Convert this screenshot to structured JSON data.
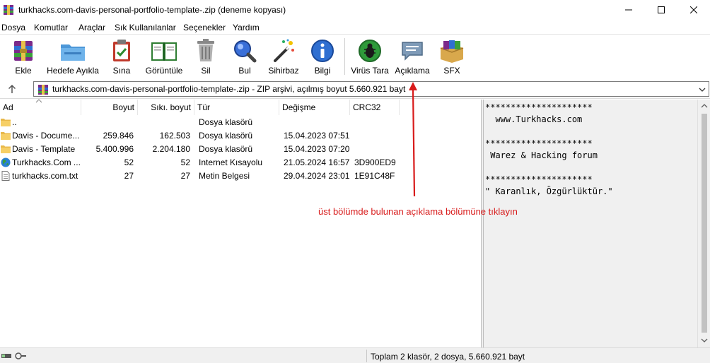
{
  "window": {
    "title": "turkhacks.com-davis-personal-portfolio-template-.zip (deneme kopyası)"
  },
  "menu": [
    "Dosya",
    "Komutlar",
    "Araçlar",
    "Sık Kullanılanlar",
    "Seçenekler",
    "Yardım"
  ],
  "toolbar": {
    "add": "Ekle",
    "extract_to": "Hedefe Ayıkla",
    "test": "Sına",
    "view": "Görüntüle",
    "delete": "Sil",
    "find": "Bul",
    "wizard": "Sihirbaz",
    "info": "Bilgi",
    "virus_scan": "Virüs Tara",
    "comment": "Açıklama",
    "sfx": "SFX"
  },
  "address": {
    "text": "turkhacks.com-davis-personal-portfolio-template-.zip - ZIP arşivi, açılmış boyut 5.660.921 bayt"
  },
  "columns": {
    "name": "Ad",
    "size": "Boyut",
    "packed": "Sıkı. boyut",
    "type": "Tür",
    "modified": "Değişme",
    "crc": "CRC32"
  },
  "files": [
    {
      "name": "..",
      "size": "",
      "packed": "",
      "type": "Dosya klasörü",
      "modified": "",
      "crc": "",
      "icon": "folder-icon"
    },
    {
      "name": "Davis - Docume...",
      "size": "259.846",
      "packed": "162.503",
      "type": "Dosya klasörü",
      "modified": "15.04.2023 07:51",
      "crc": "",
      "icon": "folder-icon"
    },
    {
      "name": "Davis - Template",
      "size": "5.400.996",
      "packed": "2.204.180",
      "type": "Dosya klasörü",
      "modified": "15.04.2023 07:20",
      "crc": "",
      "icon": "folder-icon"
    },
    {
      "name": "Turkhacks.Com ...",
      "size": "52",
      "packed": "52",
      "type": "Internet Kısayolu",
      "modified": "21.05.2024 16:57",
      "crc": "3D900ED9",
      "icon": "globe-icon"
    },
    {
      "name": "turkhacks.com.txt",
      "size": "27",
      "packed": "27",
      "type": "Metin Belgesi",
      "modified": "29.04.2024 23:01",
      "crc": "1E91C48F",
      "icon": "text-file-icon"
    }
  ],
  "comment_lines": [
    "*********************",
    "  www.Turkhacks.com",
    "",
    "*********************",
    " Warez & Hacking forum",
    "",
    "*********************",
    "\" Karanlık, Özgürlüktür.\""
  ],
  "status": {
    "text": "Toplam 2 klasör, 2 dosya, 5.660.921 bayt"
  },
  "annotation": {
    "text": "üst bölümde bulunan açıklama bölümüne tıklayın",
    "color": "#d81b1b"
  }
}
